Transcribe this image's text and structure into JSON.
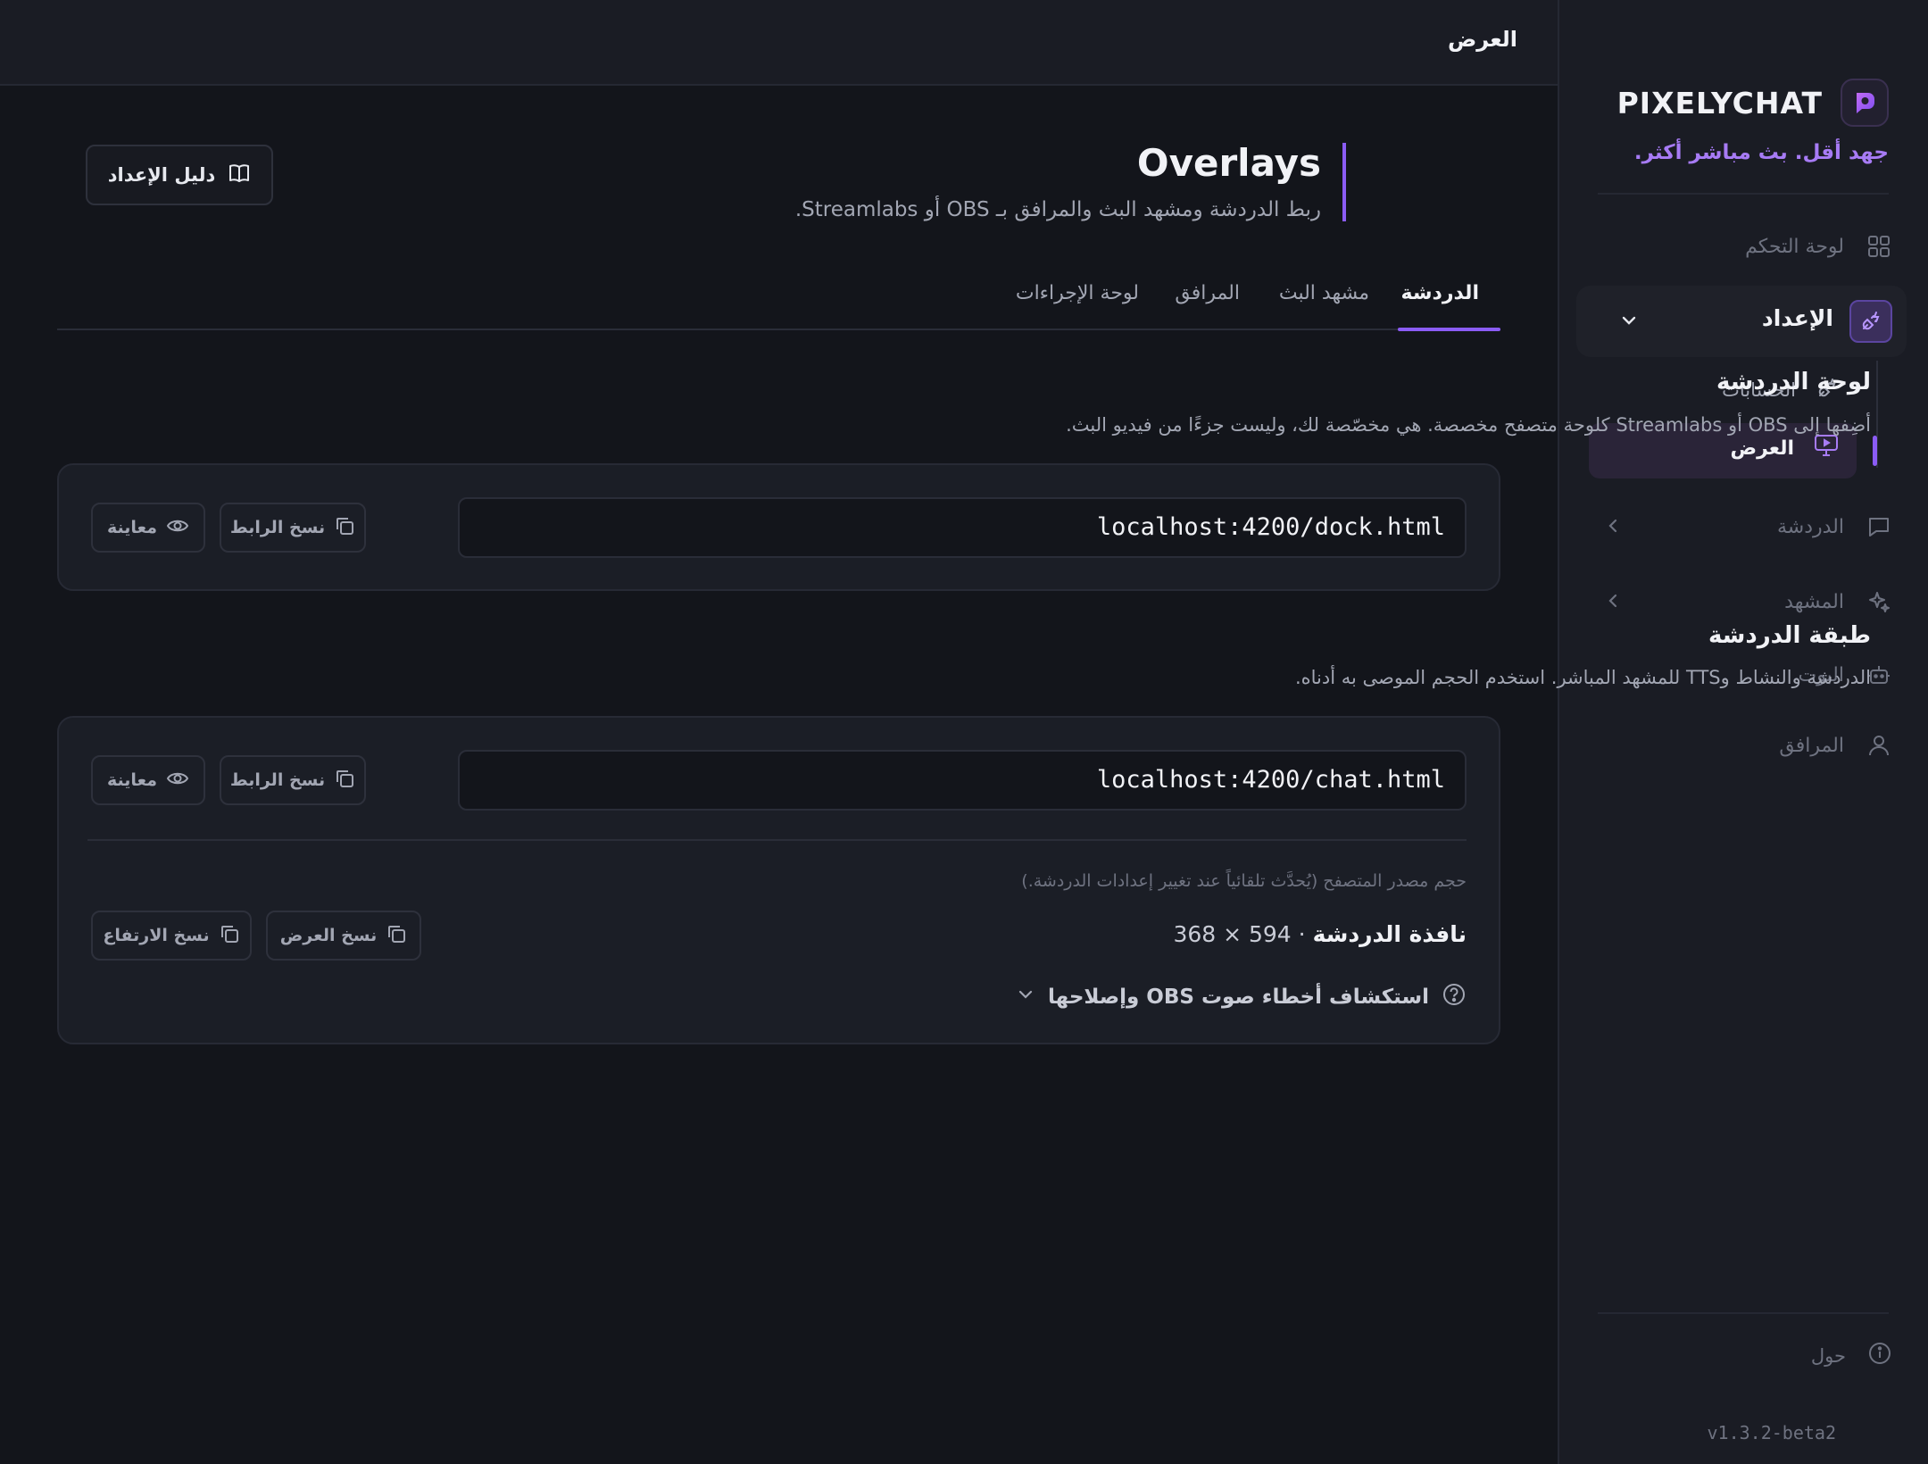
{
  "brand": {
    "name": "PIXELYCHAT",
    "tagline": "جهد أقل. بث مباشر أكثر."
  },
  "header": {
    "title": "العرض"
  },
  "sidebar": {
    "dashboard": "لوحة التحكم",
    "setup": "الإعداد",
    "sub_accounts": "الحسابات",
    "sub_display": "العرض",
    "chat": "الدردشة",
    "scene": "المشهد",
    "bot": "البوت",
    "utilities": "المرافق",
    "about": "حول",
    "version": "v1.3.2-beta2"
  },
  "page": {
    "title": "Overlays",
    "subtitle": "ربط الدردشة ومشهد البث والمرافق بـ OBS أو Streamlabs.",
    "guide_button": "دليل الإعداد"
  },
  "tabs": [
    "الدردشة",
    "مشهد البث",
    "المرافق",
    "لوحة الإجراءات"
  ],
  "dock": {
    "title": "لوحة الدردشة",
    "description": "أضِفها إلى OBS أو Streamlabs كلوحة متصفح مخصصة. هي مخصّصة لك، وليست جزءًا من فيديو البث.",
    "url": "localhost:4200/dock.html",
    "copy_label": "نسخ الرابط",
    "preview_label": "معاينة"
  },
  "overlay": {
    "title": "طبقة الدردشة",
    "description": "الدردشة والنشاط وTTS للمشهد المباشر. استخدم الحجم الموصى به أدناه.",
    "url": "localhost:4200/chat.html",
    "copy_label": "نسخ الرابط",
    "preview_label": "معاينة",
    "size_note": "حجم مصدر المتصفح (يُحدَّث تلقائياً عند تغيير إعدادات الدردشة.)",
    "size_label": "نافذة الدردشة",
    "size_value": "· 594 × 368",
    "copy_width": "نسخ العرض",
    "copy_height": "نسخ الارتفاع",
    "troubleshoot": "استكشاف أخطاء صوت OBS وإصلاحها"
  },
  "colors": {
    "accent": "#8b5cf6",
    "background": "#13151b",
    "panel": "#1a1c24"
  }
}
